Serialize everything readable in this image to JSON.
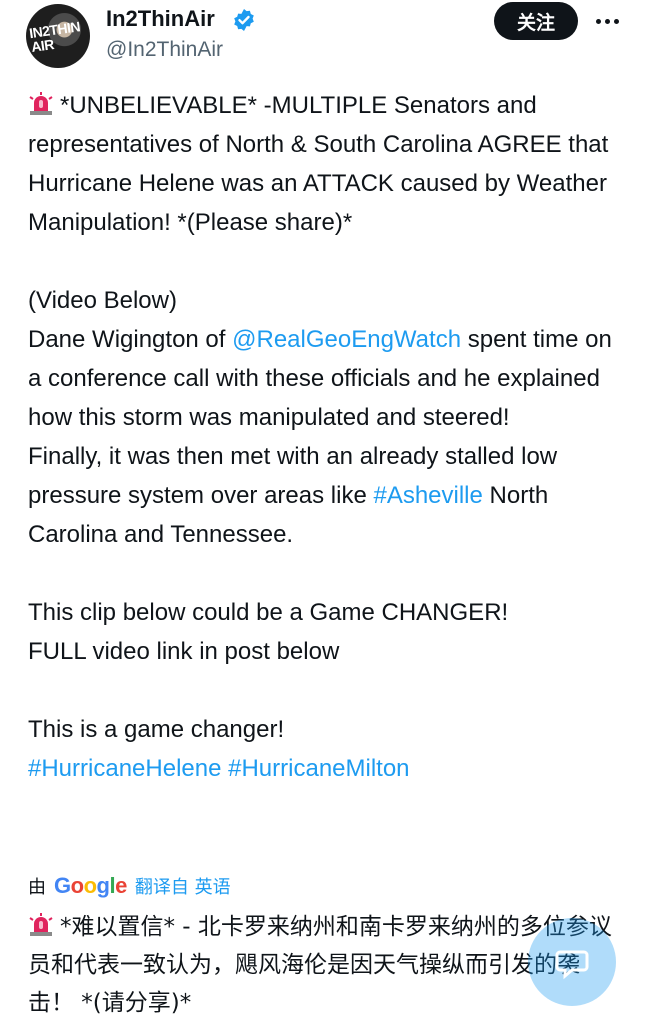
{
  "author": {
    "display_name": "In2ThinAir",
    "handle": "@In2ThinAir",
    "avatar_text": "IN2THIN AIR",
    "verified_icon": "verified-badge-icon"
  },
  "header": {
    "follow_label": "关注",
    "more_icon": "more-dots-icon"
  },
  "post": {
    "p1": "*UNBELIEVABLE* -MULTIPLE Senators and representatives of North & South Carolina AGREE that Hurricane Helene was an ATTACK caused by Weather Manipulation! *(Please share)*",
    "p2_line1": "(Video Below)",
    "p2_a": "Dane Wigington of ",
    "mention": "@RealGeoEngWatch",
    "p2_b": " spent time on a conference call with these officials and he explained how this storm was manipulated and steered!",
    "p2_c": "Finally, it was then met with an already stalled low pressure system over areas like ",
    "hashtag_asheville": "#Asheville",
    "p2_d": " North Carolina and Tennessee.",
    "p3_line1": "This clip below could be a Game CHANGER!",
    "p3_line2": "FULL video link in post below",
    "p4_line1": "This is a game changer!",
    "hashtag_helene": "#HurricaneHelene",
    "hashtag_milton": "#HurricaneMilton"
  },
  "translation": {
    "by": "由",
    "provider": "Google",
    "link_label": "翻译自 英语",
    "text": "*难以置信* - 北卡罗来纳州和南卡罗来纳州的多位参议员和代表一致认为，飓风海伦是因天气操纵而引发的袭击！ *(请分享)*"
  },
  "colors": {
    "link": "#1d9bf0",
    "text": "#0f1419",
    "secondary": "#536471",
    "siren_red": "#e0245e"
  }
}
